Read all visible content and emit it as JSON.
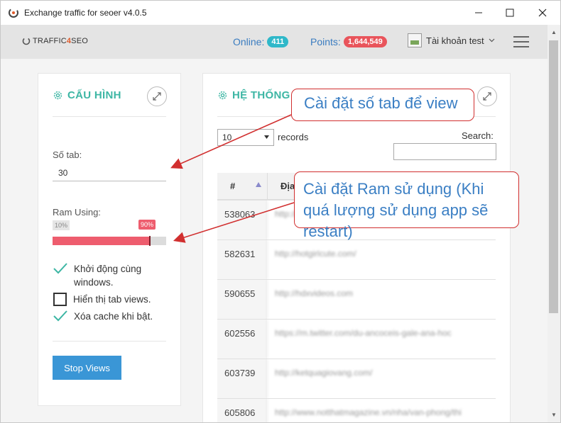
{
  "window": {
    "title": "Exchange traffic for seoer v4.0.5"
  },
  "header": {
    "logo_prefix": "TRAFFIC",
    "logo_accent": "4",
    "logo_suffix": "SEO",
    "online_label": "Online:",
    "online_count": "411",
    "points_label": "Points:",
    "points_value": "1,644,549",
    "account_name": "Tài khoản test"
  },
  "config": {
    "title": "CẤU HÌNH",
    "tab_label": "Số tab:",
    "tab_value": "30",
    "ram_label": "Ram Using:",
    "ram_min": "10%",
    "ram_value_label": "90%",
    "ram_fraction": 0.9,
    "options": [
      {
        "label": "Khởi động cùng windows.",
        "checked": true
      },
      {
        "label": "Hiển thị tab views.",
        "checked": false
      },
      {
        "label": "Xóa cache khi bật.",
        "checked": true
      }
    ],
    "stop_button": "Stop Views"
  },
  "system": {
    "title": "HỆ THỐNG",
    "page_size": "10",
    "records_label": "records",
    "search_label": "Search:",
    "columns": [
      "#",
      "Địa"
    ],
    "rows": [
      {
        "id": "538063",
        "address": "http://..."
      },
      {
        "id": "582631",
        "address": "http://hotgirlcute.com/"
      },
      {
        "id": "590655",
        "address": "http://hdxvideos.com"
      },
      {
        "id": "602556",
        "address": "https://m.twitter.com/du-ancoceis-gale-ana-hoc"
      },
      {
        "id": "603739",
        "address": "http://ketquagiovang.com/"
      },
      {
        "id": "605806",
        "address": "http://www.notthatmagazine.vn/nha/van-phong/thi"
      }
    ]
  },
  "annotations": {
    "callout_tabs": "Cài đặt số tab để view",
    "callout_ram": "Cài đặt Ram sử dụng (Khi quá lượng sử dụng app sẽ restart)"
  },
  "colors": {
    "accent_teal": "#3db6a4",
    "online_badge": "#2fb8c9",
    "points_badge": "#e9545b",
    "slider_fill": "#ee5d6e",
    "button_blue": "#3a96d6",
    "callout_border": "#d12f2f",
    "callout_text": "#3b7fc4"
  }
}
